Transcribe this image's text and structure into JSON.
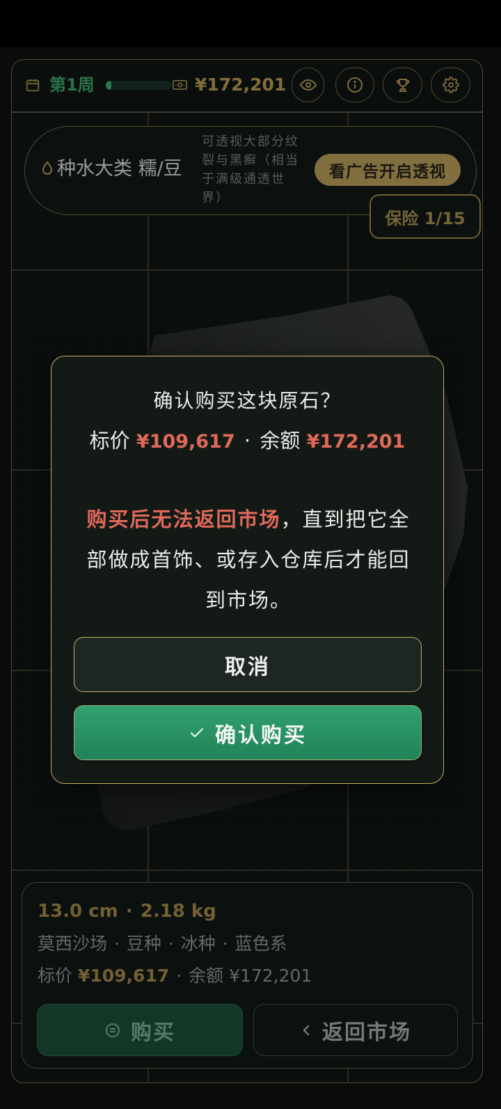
{
  "header": {
    "week_label": "第1周",
    "week_progress": 0.08,
    "balance": "¥172,201"
  },
  "hint_card": {
    "category": "种水大类 糯/豆",
    "description": "可透视大部分纹裂与黑癣（相当于满级通透世界）",
    "ad_button_label": "看广告开启透视"
  },
  "insurance_badge": "保险 1/15",
  "dialog": {
    "title": "确认购买这块原石？",
    "price_label": "标价",
    "price": "¥109,617",
    "separator": "·",
    "balance_label": "余额",
    "balance": "¥172,201",
    "warning_highlight": "购买后无法返回市场",
    "warning_rest": "，直到把它全部做成首饰、或存入仓库后才能回到市场。",
    "cancel_label": "取消",
    "confirm_label": "确认购买"
  },
  "stone_info": {
    "size": "13.0 cm",
    "weight": "2.18 kg",
    "separator": "·",
    "tags": [
      "莫西沙场",
      "豆种",
      "冰种",
      "蓝色系"
    ],
    "price_label": "标价",
    "price": "¥109,617",
    "balance_label": "余额",
    "balance": "¥172,201"
  },
  "actions": {
    "buy_label": "购买",
    "back_label": "返回市场"
  },
  "icons": {
    "week": "calendar-icon",
    "balance": "money-icon",
    "vision": "eye-icon",
    "info": "info-icon",
    "achievements": "trophy-icon",
    "settings": "gear-icon",
    "category": "droplet-icon",
    "confirm": "check-icon",
    "buy": "list-circle-icon",
    "back": "chevron-left-icon"
  },
  "colors": {
    "accent_green": "#2f9e6d",
    "gold": "#c9ad6a",
    "warning_red": "#e0695a",
    "background": "#0b100e"
  }
}
